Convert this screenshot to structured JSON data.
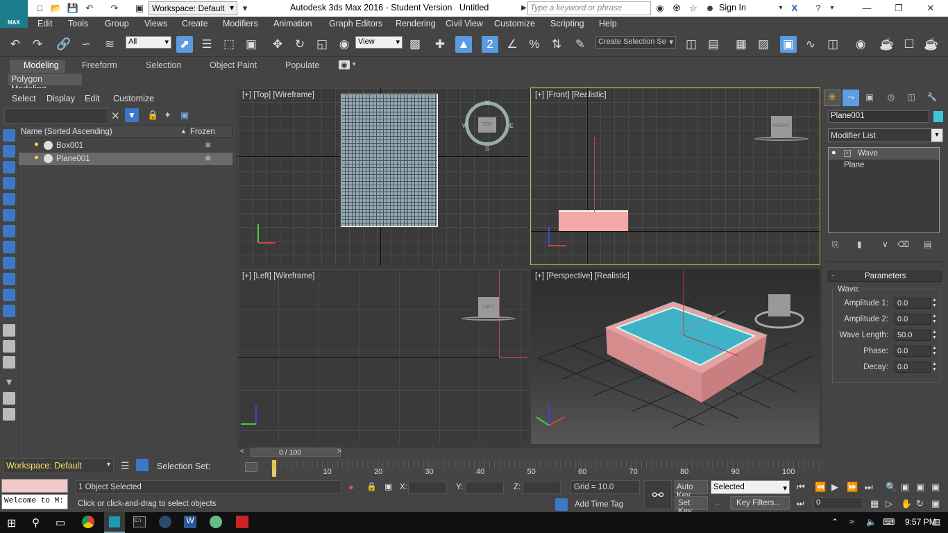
{
  "titlebar": {
    "workspace": "Workspace: Default",
    "app_title": "Autodesk 3ds Max 2016 - Student Version",
    "file": "Untitled",
    "search_placeholder": "Type a keyword or phrase",
    "sign_in": "Sign In",
    "logo": "MAX"
  },
  "menu": [
    "Edit",
    "Tools",
    "Group",
    "Views",
    "Create",
    "Modifiers",
    "Animation",
    "Graph Editors",
    "Rendering",
    "Civil View",
    "Customize",
    "Scripting",
    "Help"
  ],
  "toolbar": {
    "filter": "All",
    "ref_coord": "View",
    "selection_set": "Create Selection Se"
  },
  "ribbon": {
    "tabs": [
      "Modeling",
      "Freeform",
      "Selection",
      "Object Paint",
      "Populate"
    ],
    "active_tab": "Modeling",
    "panel_label": "Polygon Modeling"
  },
  "scene_explorer": {
    "menu": [
      "Select",
      "Display",
      "Edit",
      "Customize"
    ],
    "col_name": "Name (Sorted Ascending)",
    "col_frozen": "Frozen",
    "rows": [
      "Box001",
      "Plane001"
    ],
    "workspace": "Workspace: Default",
    "selection_set_label": "Selection Set:"
  },
  "viewports": {
    "top": "[+] [Top] [Wireframe]",
    "front": "[+] [Front] [Realistic]",
    "left": "[+] [Left] [Wireframe]",
    "perspective": "[+] [Perspective] [Realistic]",
    "cube_top": "TOP",
    "cube_front": "FRONT",
    "cube_left": "LEFT",
    "compass_n": "N",
    "compass_s": "S",
    "compass_e": "E",
    "compass_w": "W"
  },
  "command_panel": {
    "object_name": "Plane001",
    "modifier_list": "Modifier List",
    "stack": [
      "Wave",
      "Plane"
    ],
    "rollout_title": "Parameters",
    "group": "Wave:",
    "params": [
      {
        "label": "Amplitude 1:",
        "value": "0.0"
      },
      {
        "label": "Amplitude 2:",
        "value": "0.0"
      },
      {
        "label": "Wave Length:",
        "value": "50.0"
      },
      {
        "label": "Phase:",
        "value": "0.0"
      },
      {
        "label": "Decay:",
        "value": "0.0"
      }
    ],
    "color": "#3cc8d8"
  },
  "timeline": {
    "frame": "0 / 100",
    "ticks": [
      "0",
      "10",
      "20",
      "30",
      "40",
      "50",
      "60",
      "70",
      "80",
      "90",
      "100"
    ]
  },
  "status": {
    "selected": "1 Object Selected",
    "prompt": "Click or click-and-drag to select objects",
    "maxscript": "Welcome to M:",
    "x_label": "X:",
    "y_label": "Y:",
    "z_label": "Z:",
    "grid": "Grid = 10.0",
    "auto_key": "Auto Key",
    "set_key": "Set Key",
    "key_mode": "Selected",
    "key_filters": "Key Filters...",
    "add_time_tag": "Add Time Tag",
    "frame_field": "0"
  },
  "taskbar": {
    "time": "9:57 PM"
  }
}
